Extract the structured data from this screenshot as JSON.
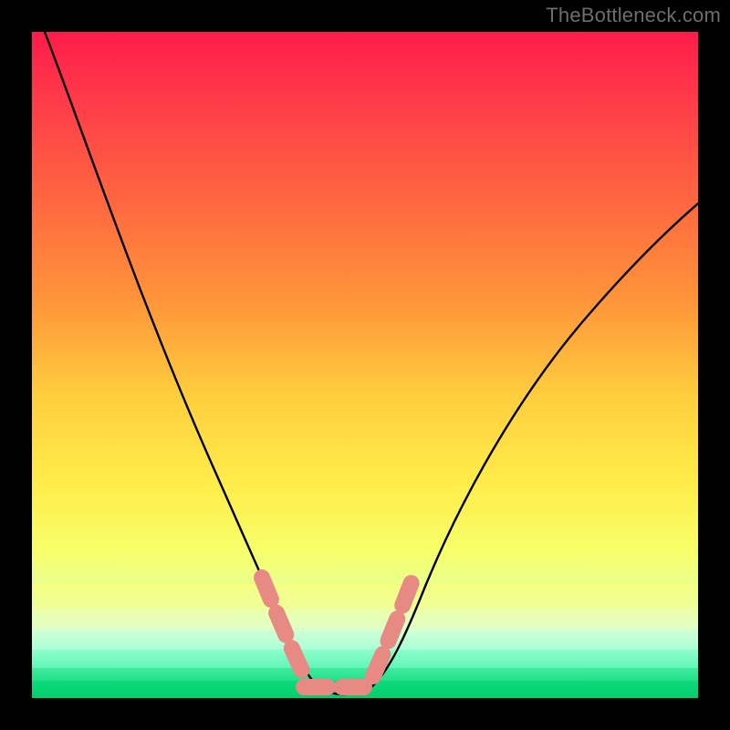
{
  "watermark": {
    "text": "TheBottleneck.com"
  },
  "chart_data": {
    "type": "line",
    "title": "",
    "xlabel": "",
    "ylabel": "",
    "xlim": [
      0,
      100
    ],
    "ylim": [
      0,
      100
    ],
    "series": [
      {
        "name": "black-curve",
        "x": [
          2,
          5,
          10,
          15,
          20,
          25,
          30,
          34,
          36,
          38,
          40,
          42,
          46,
          50,
          52,
          55,
          60,
          65,
          70,
          75,
          80,
          85,
          90,
          95,
          100
        ],
        "values": [
          100,
          90,
          76,
          64,
          52,
          41,
          30,
          19,
          12,
          6,
          2,
          0.5,
          0.5,
          0.8,
          3,
          10,
          22,
          33,
          43,
          51,
          58,
          64,
          69,
          73,
          76
        ]
      }
    ],
    "highlight_segments": [
      {
        "x": [
          31,
          35
        ],
        "y": [
          20,
          10
        ],
        "color": "#e98079"
      },
      {
        "x": [
          35,
          38
        ],
        "y": [
          10,
          3
        ],
        "color": "#e98079"
      },
      {
        "x": [
          38,
          42
        ],
        "y": [
          3,
          0.5
        ],
        "color": "#e98079"
      },
      {
        "x": [
          42,
          48
        ],
        "y": [
          0.5,
          0.5
        ],
        "color": "#e98079"
      },
      {
        "x": [
          48,
          52
        ],
        "y": [
          0.5,
          3
        ],
        "color": "#e98079"
      },
      {
        "x": [
          52,
          55
        ],
        "y": [
          3,
          10
        ],
        "color": "#e98079"
      },
      {
        "x": [
          55,
          58
        ],
        "y": [
          10,
          19
        ],
        "color": "#e98079"
      }
    ],
    "background_bands": [
      {
        "from_y": 100,
        "to_y": 17,
        "color_top": "#ff1b4a",
        "color_bottom": "#f6ff7a"
      },
      {
        "from_y": 17,
        "to_y": 10,
        "color_top": "#f1ff91",
        "color_bottom": "#e2ffc0"
      },
      {
        "from_y": 10,
        "to_y": 4,
        "color_top": "#c2ffd2",
        "color_bottom": "#74ffbf"
      },
      {
        "from_y": 4,
        "to_y": 0,
        "color_top": "#2fe88e",
        "color_bottom": "#00d86f"
      }
    ]
  }
}
